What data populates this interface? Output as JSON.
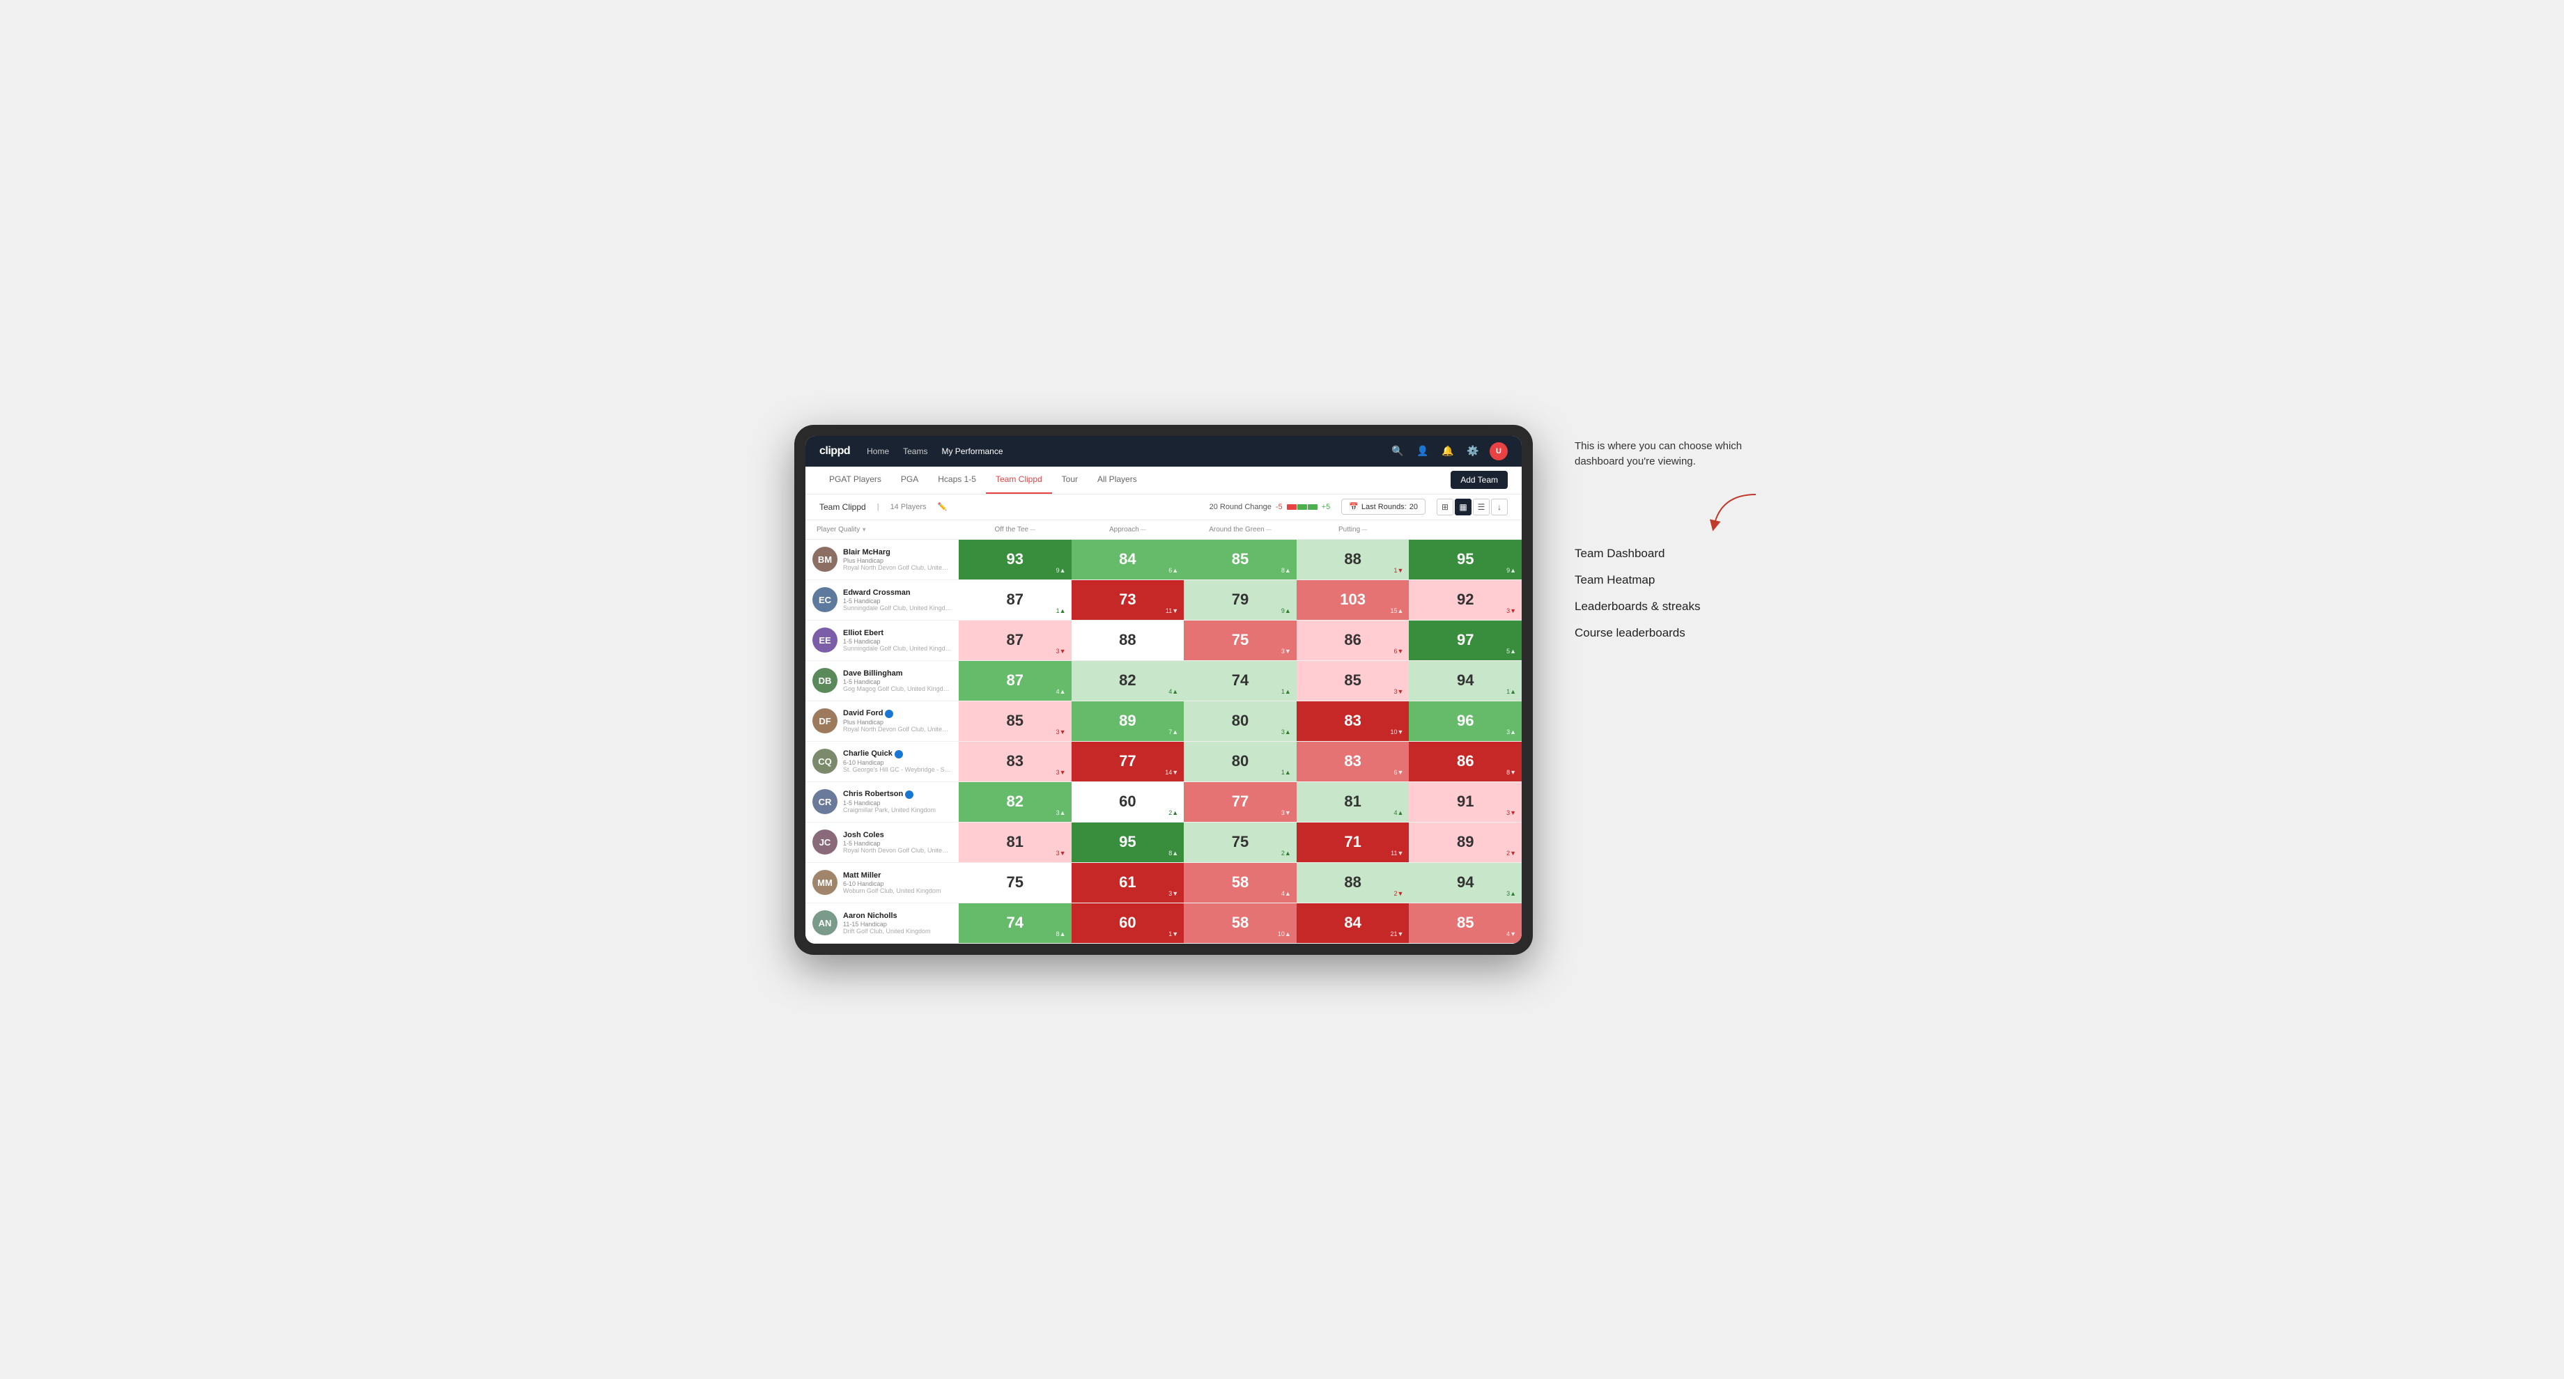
{
  "annotation": {
    "description": "This is where you can choose which dashboard you're viewing.",
    "arrow_hint": "→",
    "options": [
      {
        "label": "Team Dashboard"
      },
      {
        "label": "Team Heatmap"
      },
      {
        "label": "Leaderboards & streaks"
      },
      {
        "label": "Course leaderboards"
      }
    ]
  },
  "navbar": {
    "logo": "clippd",
    "links": [
      {
        "label": "Home",
        "active": false
      },
      {
        "label": "Teams",
        "active": false
      },
      {
        "label": "My Performance",
        "active": true
      }
    ],
    "icons": [
      "search",
      "person",
      "bell",
      "settings",
      "avatar"
    ]
  },
  "subnav": {
    "links": [
      {
        "label": "PGAT Players",
        "active": false
      },
      {
        "label": "PGA",
        "active": false
      },
      {
        "label": "Hcaps 1-5",
        "active": false
      },
      {
        "label": "Team Clippd",
        "active": true
      },
      {
        "label": "Tour",
        "active": false
      },
      {
        "label": "All Players",
        "active": false
      }
    ],
    "add_team_label": "Add Team"
  },
  "team_bar": {
    "team_name": "Team Clippd",
    "player_count": "14 Players",
    "round_change_label": "20 Round Change",
    "change_minus": "-5",
    "change_plus": "+5",
    "last_rounds_label": "Last Rounds:",
    "last_rounds_value": "20"
  },
  "table": {
    "headers": [
      {
        "label": "Player Quality",
        "sortable": true
      },
      {
        "label": "Off the Tee",
        "sortable": true
      },
      {
        "label": "Approach",
        "sortable": true
      },
      {
        "label": "Around the Green",
        "sortable": true
      },
      {
        "label": "Putting",
        "sortable": true
      }
    ],
    "rows": [
      {
        "name": "Blair McHarg",
        "handicap": "Plus Handicap",
        "club": "Royal North Devon Golf Club, United Kingdom",
        "avatar_color": "#8d6e63",
        "initials": "BM",
        "scores": [
          {
            "value": 93,
            "change": "+9",
            "dir": "up",
            "bg": "bg-green-strong"
          },
          {
            "value": 84,
            "change": "+6",
            "dir": "up",
            "bg": "bg-green-medium"
          },
          {
            "value": 85,
            "change": "+8",
            "dir": "up",
            "bg": "bg-green-medium"
          },
          {
            "value": 88,
            "change": "-1",
            "dir": "down",
            "bg": "bg-green-light"
          },
          {
            "value": 95,
            "change": "+9",
            "dir": "up",
            "bg": "bg-green-strong"
          }
        ]
      },
      {
        "name": "Edward Crossman",
        "handicap": "1-5 Handicap",
        "club": "Sunningdale Golf Club, United Kingdom",
        "avatar_color": "#5d7a9e",
        "initials": "EC",
        "scores": [
          {
            "value": 87,
            "change": "+1",
            "dir": "up",
            "bg": "bg-white"
          },
          {
            "value": 73,
            "change": "-11",
            "dir": "down",
            "bg": "bg-red-strong"
          },
          {
            "value": 79,
            "change": "+9",
            "dir": "up",
            "bg": "bg-green-light"
          },
          {
            "value": 103,
            "change": "+15",
            "dir": "up",
            "bg": "bg-red-medium"
          },
          {
            "value": 92,
            "change": "-3",
            "dir": "down",
            "bg": "bg-red-light"
          }
        ]
      },
      {
        "name": "Elliot Ebert",
        "handicap": "1-5 Handicap",
        "club": "Sunningdale Golf Club, United Kingdom",
        "avatar_color": "#7b5ea7",
        "initials": "EE",
        "scores": [
          {
            "value": 87,
            "change": "-3",
            "dir": "down",
            "bg": "bg-red-light"
          },
          {
            "value": 88,
            "change": "",
            "dir": "",
            "bg": "bg-white"
          },
          {
            "value": 75,
            "change": "-3",
            "dir": "down",
            "bg": "bg-red-medium"
          },
          {
            "value": 86,
            "change": "-6",
            "dir": "down",
            "bg": "bg-red-light"
          },
          {
            "value": 97,
            "change": "+5",
            "dir": "up",
            "bg": "bg-green-strong"
          }
        ]
      },
      {
        "name": "Dave Billingham",
        "handicap": "1-5 Handicap",
        "club": "Gog Magog Golf Club, United Kingdom",
        "avatar_color": "#5a8a5a",
        "initials": "DB",
        "scores": [
          {
            "value": 87,
            "change": "+4",
            "dir": "up",
            "bg": "bg-green-medium"
          },
          {
            "value": 82,
            "change": "+4",
            "dir": "up",
            "bg": "bg-green-light"
          },
          {
            "value": 74,
            "change": "+1",
            "dir": "up",
            "bg": "bg-green-light"
          },
          {
            "value": 85,
            "change": "-3",
            "dir": "down",
            "bg": "bg-red-light"
          },
          {
            "value": 94,
            "change": "+1",
            "dir": "up",
            "bg": "bg-green-light"
          }
        ]
      },
      {
        "name": "David Ford",
        "handicap": "Plus Handicap",
        "club": "Royal North Devon Golf Club, United Kingdom",
        "avatar_color": "#9e7a5d",
        "initials": "DF",
        "verified": true,
        "scores": [
          {
            "value": 85,
            "change": "-3",
            "dir": "down",
            "bg": "bg-red-light"
          },
          {
            "value": 89,
            "change": "+7",
            "dir": "up",
            "bg": "bg-green-medium"
          },
          {
            "value": 80,
            "change": "+3",
            "dir": "up",
            "bg": "bg-green-light"
          },
          {
            "value": 83,
            "change": "-10",
            "dir": "down",
            "bg": "bg-red-strong"
          },
          {
            "value": 96,
            "change": "+3",
            "dir": "up",
            "bg": "bg-green-medium"
          }
        ]
      },
      {
        "name": "Charlie Quick",
        "handicap": "6-10 Handicap",
        "club": "St. George's Hill GC - Weybridge - Surrey, Uni...",
        "avatar_color": "#7a8a6a",
        "initials": "CQ",
        "verified": true,
        "scores": [
          {
            "value": 83,
            "change": "-3",
            "dir": "down",
            "bg": "bg-red-light"
          },
          {
            "value": 77,
            "change": "-14",
            "dir": "down",
            "bg": "bg-red-strong"
          },
          {
            "value": 80,
            "change": "+1",
            "dir": "up",
            "bg": "bg-green-light"
          },
          {
            "value": 83,
            "change": "-6",
            "dir": "down",
            "bg": "bg-red-medium"
          },
          {
            "value": 86,
            "change": "-8",
            "dir": "down",
            "bg": "bg-red-strong"
          }
        ]
      },
      {
        "name": "Chris Robertson",
        "handicap": "1-5 Handicap",
        "club": "Craigmillar Park, United Kingdom",
        "avatar_color": "#6a7a9a",
        "initials": "CR",
        "verified": true,
        "scores": [
          {
            "value": 82,
            "change": "+3",
            "dir": "up",
            "bg": "bg-green-medium"
          },
          {
            "value": 60,
            "change": "+2",
            "dir": "up",
            "bg": "bg-white"
          },
          {
            "value": 77,
            "change": "-3",
            "dir": "down",
            "bg": "bg-red-medium"
          },
          {
            "value": 81,
            "change": "+4",
            "dir": "up",
            "bg": "bg-green-light"
          },
          {
            "value": 91,
            "change": "-3",
            "dir": "down",
            "bg": "bg-red-light"
          }
        ]
      },
      {
        "name": "Josh Coles",
        "handicap": "1-5 Handicap",
        "club": "Royal North Devon Golf Club, United Kingdom",
        "avatar_color": "#8a6a7a",
        "initials": "JC",
        "scores": [
          {
            "value": 81,
            "change": "-3",
            "dir": "down",
            "bg": "bg-red-light"
          },
          {
            "value": 95,
            "change": "+8",
            "dir": "up",
            "bg": "bg-green-strong"
          },
          {
            "value": 75,
            "change": "+2",
            "dir": "up",
            "bg": "bg-green-light"
          },
          {
            "value": 71,
            "change": "-11",
            "dir": "down",
            "bg": "bg-red-strong"
          },
          {
            "value": 89,
            "change": "-2",
            "dir": "down",
            "bg": "bg-red-light"
          }
        ]
      },
      {
        "name": "Matt Miller",
        "handicap": "6-10 Handicap",
        "club": "Woburn Golf Club, United Kingdom",
        "avatar_color": "#a0856a",
        "initials": "MM",
        "scores": [
          {
            "value": 75,
            "change": "",
            "dir": "",
            "bg": "bg-white"
          },
          {
            "value": 61,
            "change": "-3",
            "dir": "down",
            "bg": "bg-red-strong"
          },
          {
            "value": 58,
            "change": "+4",
            "dir": "up",
            "bg": "bg-red-medium"
          },
          {
            "value": 88,
            "change": "-2",
            "dir": "down",
            "bg": "bg-green-light"
          },
          {
            "value": 94,
            "change": "+3",
            "dir": "up",
            "bg": "bg-green-light"
          }
        ]
      },
      {
        "name": "Aaron Nicholls",
        "handicap": "11-15 Handicap",
        "club": "Drift Golf Club, United Kingdom",
        "avatar_color": "#7a9a8a",
        "initials": "AN",
        "scores": [
          {
            "value": 74,
            "change": "+8",
            "dir": "up",
            "bg": "bg-green-medium"
          },
          {
            "value": 60,
            "change": "-1",
            "dir": "down",
            "bg": "bg-red-strong"
          },
          {
            "value": 58,
            "change": "+10",
            "dir": "up",
            "bg": "bg-red-medium"
          },
          {
            "value": 84,
            "change": "-21",
            "dir": "down",
            "bg": "bg-red-strong"
          },
          {
            "value": 85,
            "change": "-4",
            "dir": "down",
            "bg": "bg-red-medium"
          }
        ]
      }
    ]
  }
}
